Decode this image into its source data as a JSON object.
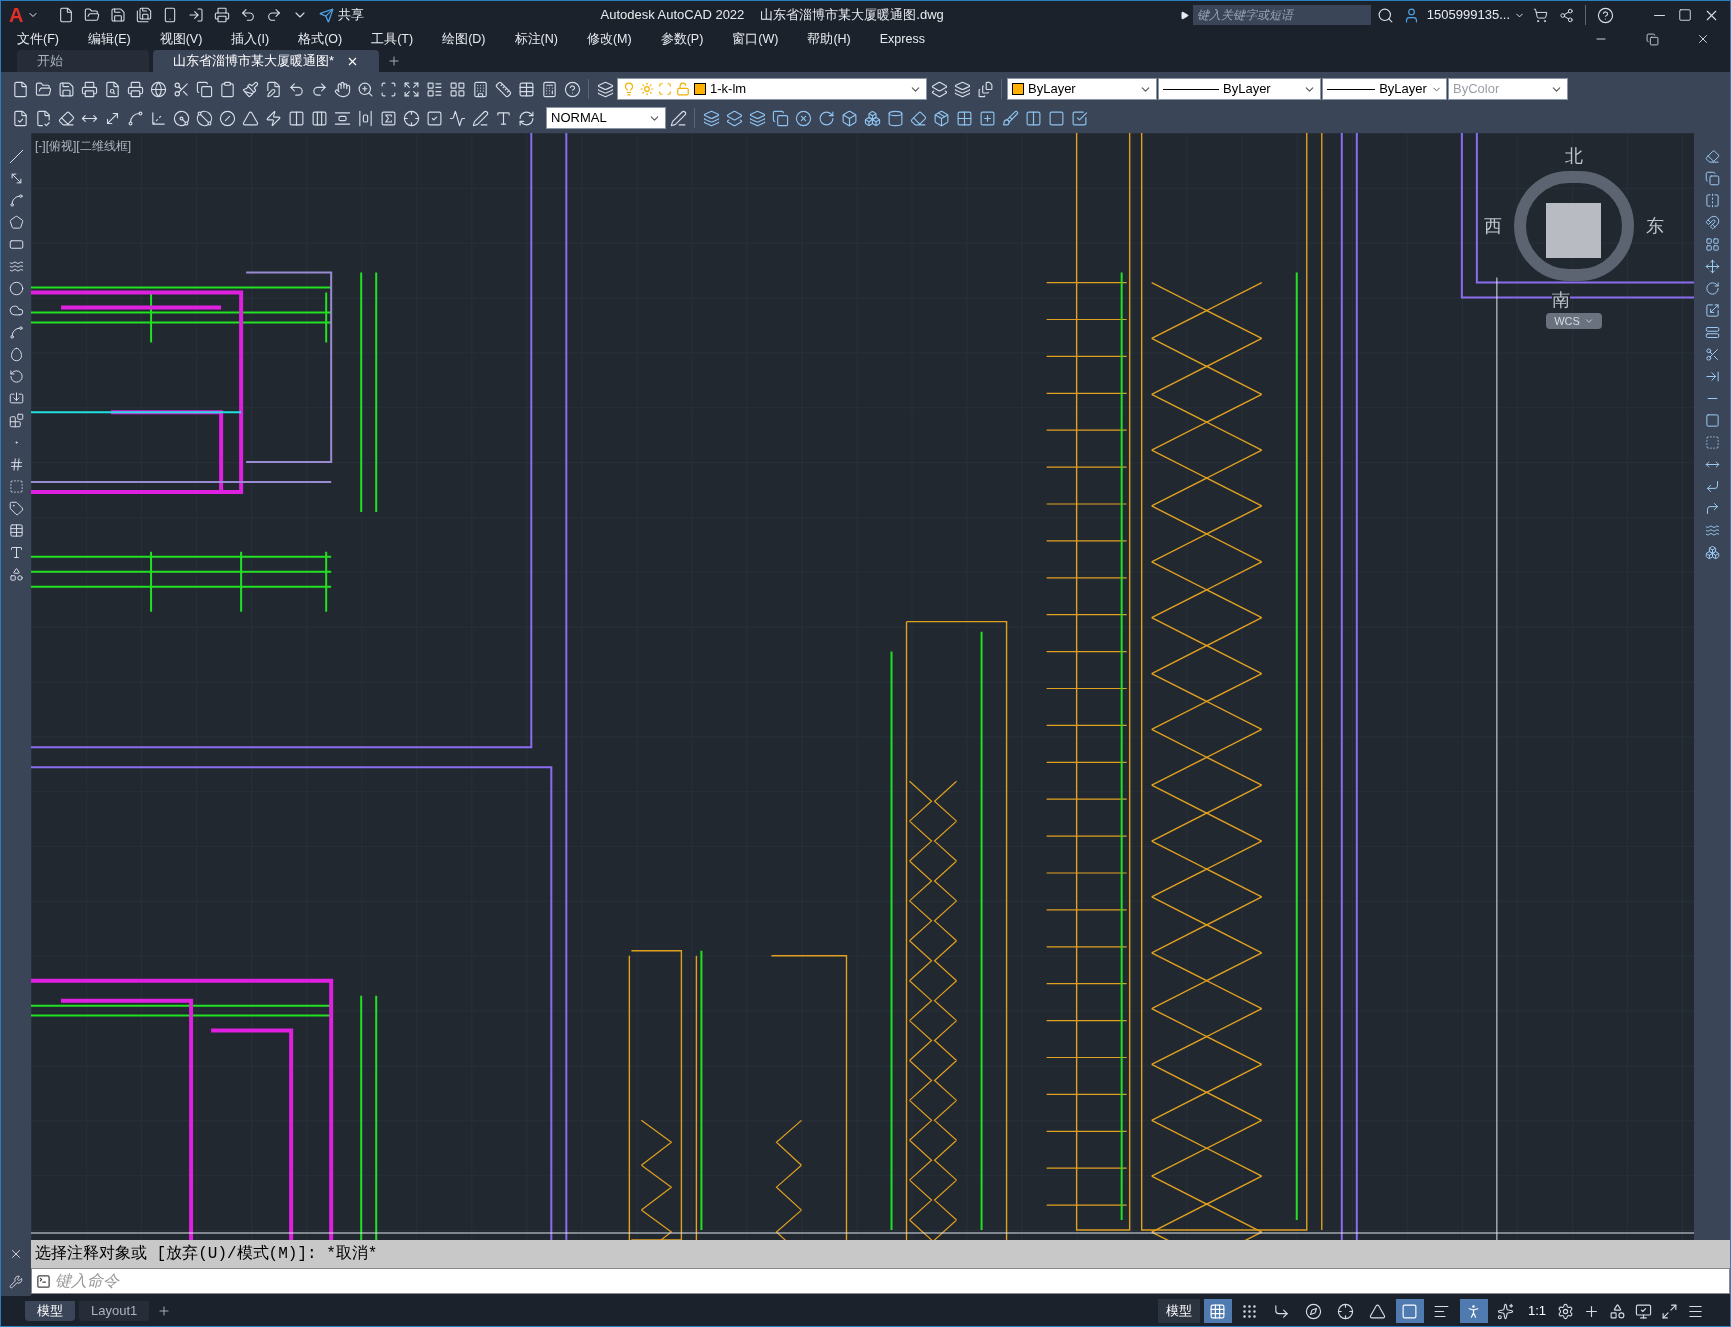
{
  "title_bar": {
    "logo": "A",
    "share_label": "共享",
    "app_name": "Autodesk AutoCAD 2022",
    "file_name": "山东省淄博市某大厦暖通图.dwg",
    "search": {
      "placeholder": "键入关键字或短语"
    },
    "user": "1505999135..."
  },
  "menu": [
    "文件(F)",
    "编辑(E)",
    "视图(V)",
    "插入(I)",
    "格式(O)",
    "工具(T)",
    "绘图(D)",
    "标注(N)",
    "修改(M)",
    "参数(P)",
    "窗口(W)",
    "帮助(H)",
    "Express"
  ],
  "tabs": [
    {
      "label": "开始",
      "selected": false
    },
    {
      "label": "山东省淄博市某大厦暖通图*",
      "selected": true
    }
  ],
  "toolbar": {
    "layer": "1-k-lm",
    "color_setting": "ByLayer",
    "linetype": "ByLayer",
    "lineweight": "ByLayer",
    "plot_style": {
      "value": "ByColor",
      "disabled": true
    },
    "dim_style": "NORMAL"
  },
  "viewport_label": "[-][俯视][二维线框]",
  "viewcube": {
    "north": "北",
    "south": "南",
    "west": "西",
    "east": "东",
    "ucs": "WCS"
  },
  "command": {
    "history": "选择注释对象或 [放弃(U)/模式(M)]: *取消*",
    "placeholder": "键入命令"
  },
  "layout_tabs": [
    {
      "label": "模型",
      "selected": true
    },
    {
      "label": "Layout1",
      "selected": false
    }
  ],
  "status_bar": {
    "model_label": "模型",
    "scale": "1:1",
    "toggles": [
      {
        "kind": "grid",
        "on": true
      },
      {
        "kind": "snap",
        "on": false
      },
      {
        "kind": "ortho",
        "on": false
      },
      {
        "kind": "polar",
        "on": false
      },
      {
        "kind": "track",
        "on": false
      },
      {
        "kind": "angle",
        "on": false
      },
      {
        "kind": "osnap",
        "on": true
      },
      {
        "kind": "lineweight",
        "on": false
      },
      {
        "kind": "annotation",
        "on": true
      },
      {
        "kind": "autoscale",
        "on": false
      }
    ]
  }
}
